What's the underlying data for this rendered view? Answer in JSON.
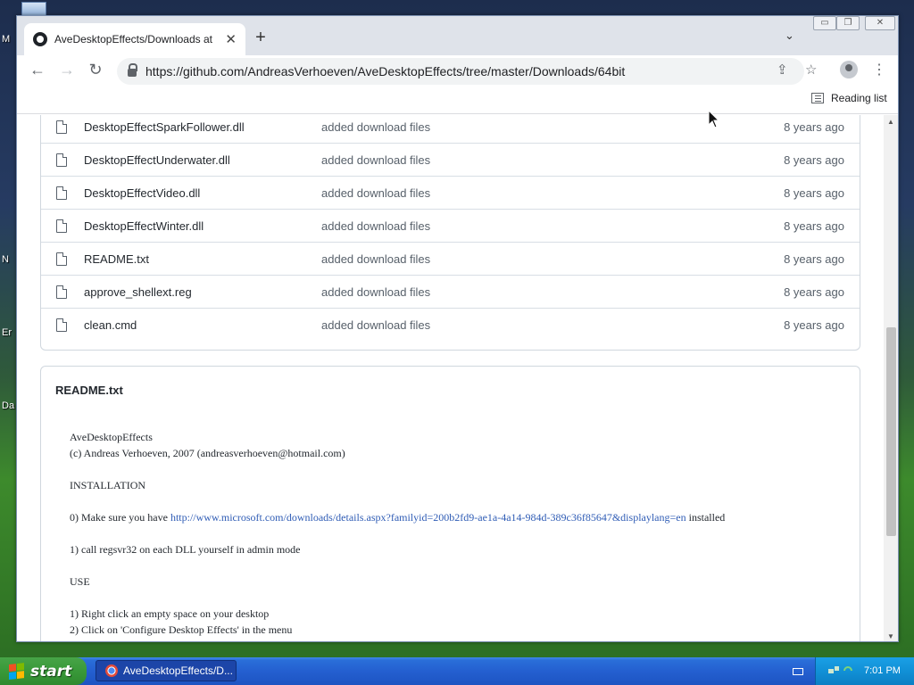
{
  "desktop": {
    "labels": [
      "M",
      "N",
      "Er",
      "Da"
    ]
  },
  "browser": {
    "tab_title": "AveDesktopEffects/Downloads at m",
    "url": "https://github.com/AndreasVerhoeven/AveDesktopEffects/tree/master/Downloads/64bit",
    "reading_list_label": "Reading list"
  },
  "files": [
    {
      "name": "DesktopEffectSparkFollower.dll",
      "message": "added download files",
      "age": "8 years ago"
    },
    {
      "name": "DesktopEffectUnderwater.dll",
      "message": "added download files",
      "age": "8 years ago"
    },
    {
      "name": "DesktopEffectVideo.dll",
      "message": "added download files",
      "age": "8 years ago"
    },
    {
      "name": "DesktopEffectWinter.dll",
      "message": "added download files",
      "age": "8 years ago"
    },
    {
      "name": "README.txt",
      "message": "added download files",
      "age": "8 years ago"
    },
    {
      "name": "approve_shellext.reg",
      "message": "added download files",
      "age": "8 years ago"
    },
    {
      "name": "clean.cmd",
      "message": "added download files",
      "age": "8 years ago"
    }
  ],
  "readme": {
    "title": "README.txt",
    "lines": {
      "l1": "AveDesktopEffects",
      "l2": "(c) Andreas Verhoeven, 2007 (andreasverhoeven@hotmail.com)",
      "l3": "INSTALLATION",
      "l4_pre": "0) Make sure you have ",
      "l4_link": "http://www.microsoft.com/downloads/details.aspx?familyid=200b2fd9-ae1a-4a14-984d-389c36f85647&displaylang=en",
      "l4_post": " installed",
      "l5": "1) call regsvr32 on each DLL yourself in admin mode",
      "l6": "USE",
      "l7": "1) Right click an empty space on your desktop",
      "l8": "2) Click on 'Configure Desktop Effects' in the menu"
    }
  },
  "taskbar": {
    "start_label": "start",
    "task_label": "AveDesktopEffects/D...",
    "clock": "7:01 PM"
  },
  "colors": {
    "taskbar": "#245fd0",
    "start": "#3a9a3a",
    "link": "#2f5cb5"
  }
}
